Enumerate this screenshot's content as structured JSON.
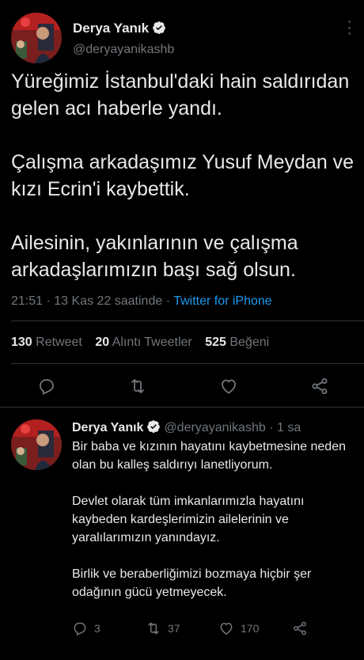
{
  "main_tweet": {
    "author_name": "Derya Yanık",
    "handle": "@deryayanikashb",
    "paragraphs": [
      "Yüreğimiz İstanbul'daki hain saldırıdan gelen acı haberle yandı.",
      "Çalışma arkadaşımız Yusuf Meydan ve kızı Ecrin'i kaybettik.",
      "Ailesinin, yakınlarının ve çalışma arkadaşlarımızın başı sağ olsun."
    ],
    "timestamp": "21:51 · 13 Kas 22 saatinde · ",
    "source": "Twitter for iPhone",
    "stats": {
      "retweet_count": "130",
      "retweet_label": "Retweet",
      "quote_count": "20",
      "quote_label": "Alıntı Tweetler",
      "like_count": "525",
      "like_label": "Beğeni"
    }
  },
  "reply_tweet": {
    "author_name": "Derya Yanık",
    "handle_time": "@deryayanikashb · 1 sa",
    "paragraphs": [
      "Bir baba ve kızının hayatını kaybetmesine neden olan bu kalleş saldırıyı lanetliyorum.",
      "Devlet olarak tüm imkanlarımızla hayatını kaybeden kardeşlerimizin ailelerinin ve yaralılarımızın yanındayız.",
      "Birlik ve beraberliğimizi bozmaya hiçbir şer odağının gücü yetmeyecek."
    ],
    "reply_count": "3",
    "retweet_count": "37",
    "like_count": "170"
  },
  "colors": {
    "background": "#000000",
    "text": "#e7e9ea",
    "secondary": "#71767b",
    "accent": "#1d9bf0",
    "divider": "#2f3336"
  },
  "icons": [
    "verified-badge-icon",
    "more-icon",
    "reply-icon",
    "retweet-icon",
    "like-icon",
    "share-icon"
  ]
}
